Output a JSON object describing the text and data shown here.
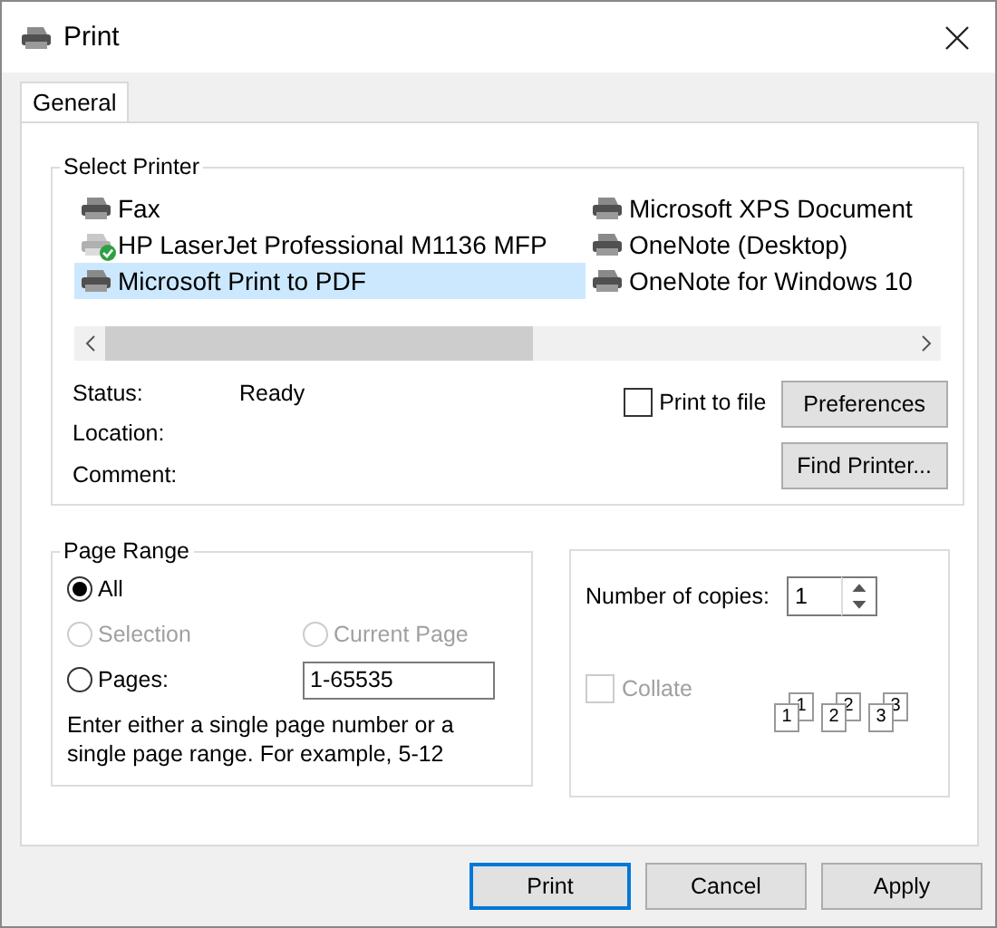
{
  "window": {
    "title": "Print"
  },
  "tabs": [
    {
      "label": "General",
      "selected": true
    }
  ],
  "select_printer": {
    "title": "Select Printer",
    "printers": [
      {
        "name": "Fax",
        "selected": false,
        "default": false
      },
      {
        "name": "HP LaserJet Professional M1136 MFP",
        "selected": false,
        "default": true
      },
      {
        "name": "Microsoft Print to PDF",
        "selected": true,
        "default": false
      },
      {
        "name": "Microsoft XPS Document",
        "selected": false,
        "default": false
      },
      {
        "name": "OneNote (Desktop)",
        "selected": false,
        "default": false
      },
      {
        "name": "OneNote for Windows 10",
        "selected": false,
        "default": false
      }
    ],
    "status": [
      {
        "label": "Status:",
        "value": "Ready"
      },
      {
        "label": "Location:"
      },
      {
        "label": "Comment:"
      }
    ],
    "print_to_file": {
      "label": "Print to file",
      "checked": false
    },
    "buttons": [
      "Preferences",
      "Find Printer..."
    ]
  },
  "page_range": {
    "title": "Page Range",
    "options": [
      {
        "label": "All",
        "selected": true,
        "disabled": false
      },
      {
        "label": "Selection",
        "selected": false,
        "disabled": true
      },
      {
        "label": "Current Page",
        "selected": false,
        "disabled": true
      },
      {
        "label": "Pages:",
        "selected": false,
        "disabled": false
      }
    ],
    "pages_field": {
      "value": "1-65535"
    },
    "hint": "Enter either a single page number or a single page range.  For example, 5-12"
  },
  "copies": {
    "label": "Number of copies:",
    "value": "1",
    "collate": {
      "label": "Collate",
      "checked": false,
      "disabled": true
    },
    "collate_pages": [
      {
        "front": "1",
        "back": "1"
      },
      {
        "front": "2",
        "back": "2"
      },
      {
        "front": "3",
        "back": "3"
      }
    ]
  },
  "buttons": [
    {
      "label": "Print",
      "default": true
    },
    {
      "label": "Cancel",
      "default": false
    },
    {
      "label": "Apply",
      "default": false
    }
  ]
}
